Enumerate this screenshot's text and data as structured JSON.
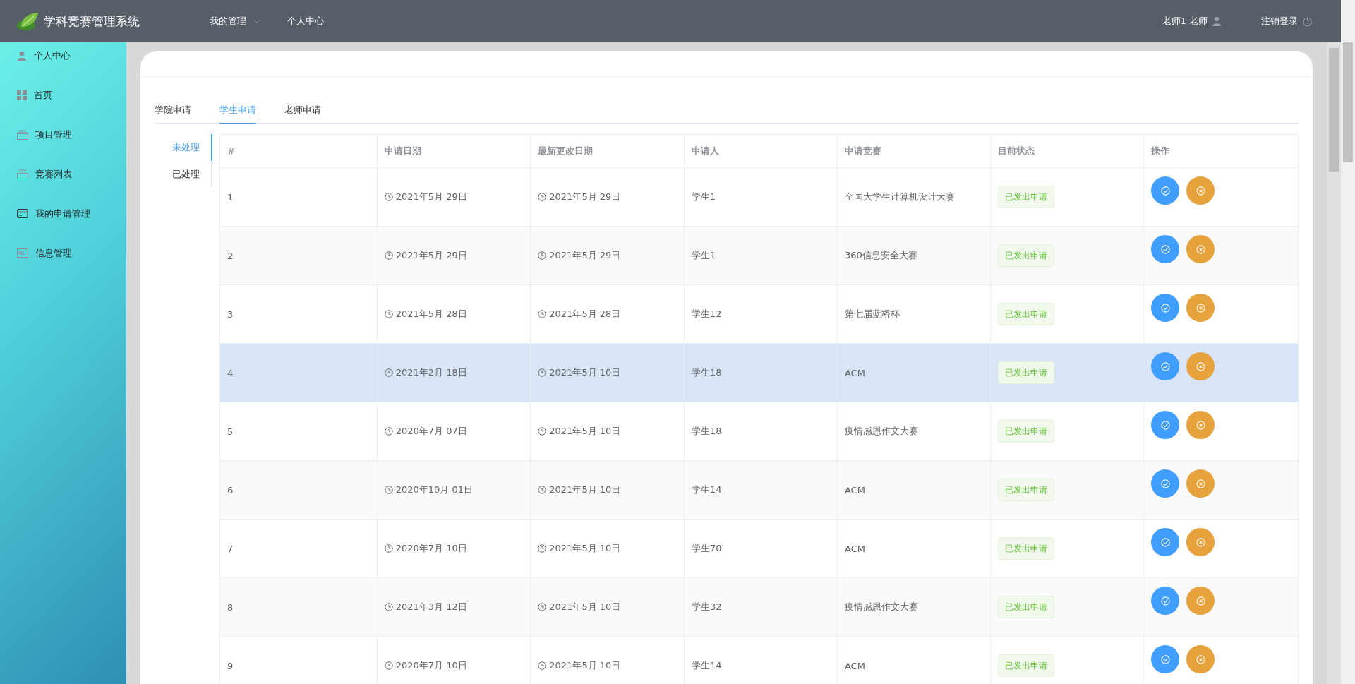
{
  "header": {
    "title": "学科竞赛管理系统",
    "nav": [
      {
        "label": "我的管理",
        "dropdown": true
      },
      {
        "label": "个人中心",
        "dropdown": false
      }
    ],
    "user": "老师1 老师",
    "logout": "注销登录"
  },
  "sidebar": {
    "items": [
      {
        "label": "个人中心",
        "kind": "person"
      },
      {
        "label": "首页",
        "kind": "grid"
      },
      {
        "label": "项目管理",
        "kind": "tray"
      },
      {
        "label": "竞赛列表",
        "kind": "tray"
      },
      {
        "label": "我的申请管理",
        "kind": "card"
      },
      {
        "label": "信息管理",
        "kind": "doc"
      }
    ]
  },
  "tabs": [
    {
      "label": "学院申请",
      "selected": false
    },
    {
      "label": "学生申请",
      "selected": true
    },
    {
      "label": "老师申请",
      "selected": false
    }
  ],
  "side_tabs": [
    {
      "label": "未处理",
      "selected": true
    },
    {
      "label": "已处理",
      "selected": false
    }
  ],
  "table": {
    "columns": [
      "#",
      "申请日期",
      "最新更改日期",
      "申请人",
      "申请竞赛",
      "目前状态",
      "操作"
    ],
    "rows": [
      {
        "no": "1",
        "applied": "2021年5月 29日",
        "updated": "2021年5月 29日",
        "applicant": "学生1",
        "contest": "全国大学生计算机设计大赛",
        "status": "已发出申请",
        "highlighted": false
      },
      {
        "no": "2",
        "applied": "2021年5月 29日",
        "updated": "2021年5月 29日",
        "applicant": "学生1",
        "contest": "360信息安全大赛",
        "status": "已发出申请",
        "highlighted": false
      },
      {
        "no": "3",
        "applied": "2021年5月 28日",
        "updated": "2021年5月 28日",
        "applicant": "学生12",
        "contest": "第七届蓝桥杯",
        "status": "已发出申请",
        "highlighted": false
      },
      {
        "no": "4",
        "applied": "2021年2月 18日",
        "updated": "2021年5月 10日",
        "applicant": "学生18",
        "contest": "ACM",
        "status": "已发出申请",
        "highlighted": true
      },
      {
        "no": "5",
        "applied": "2020年7月 07日",
        "updated": "2021年5月 10日",
        "applicant": "学生18",
        "contest": "疫情感恩作文大赛",
        "status": "已发出申请",
        "highlighted": false
      },
      {
        "no": "6",
        "applied": "2020年10月 01日",
        "updated": "2021年5月 10日",
        "applicant": "学生14",
        "contest": "ACM",
        "status": "已发出申请",
        "highlighted": false
      },
      {
        "no": "7",
        "applied": "2020年7月 10日",
        "updated": "2021年5月 10日",
        "applicant": "学生70",
        "contest": "ACM",
        "status": "已发出申请",
        "highlighted": false
      },
      {
        "no": "8",
        "applied": "2021年3月 12日",
        "updated": "2021年5月 10日",
        "applicant": "学生32",
        "contest": "疫情感恩作文大赛",
        "status": "已发出申请",
        "highlighted": false
      },
      {
        "no": "9",
        "applied": "2020年7月 10日",
        "updated": "2021年5月 10日",
        "applicant": "学生14",
        "contest": "ACM",
        "status": "已发出申请",
        "highlighted": false
      }
    ]
  }
}
